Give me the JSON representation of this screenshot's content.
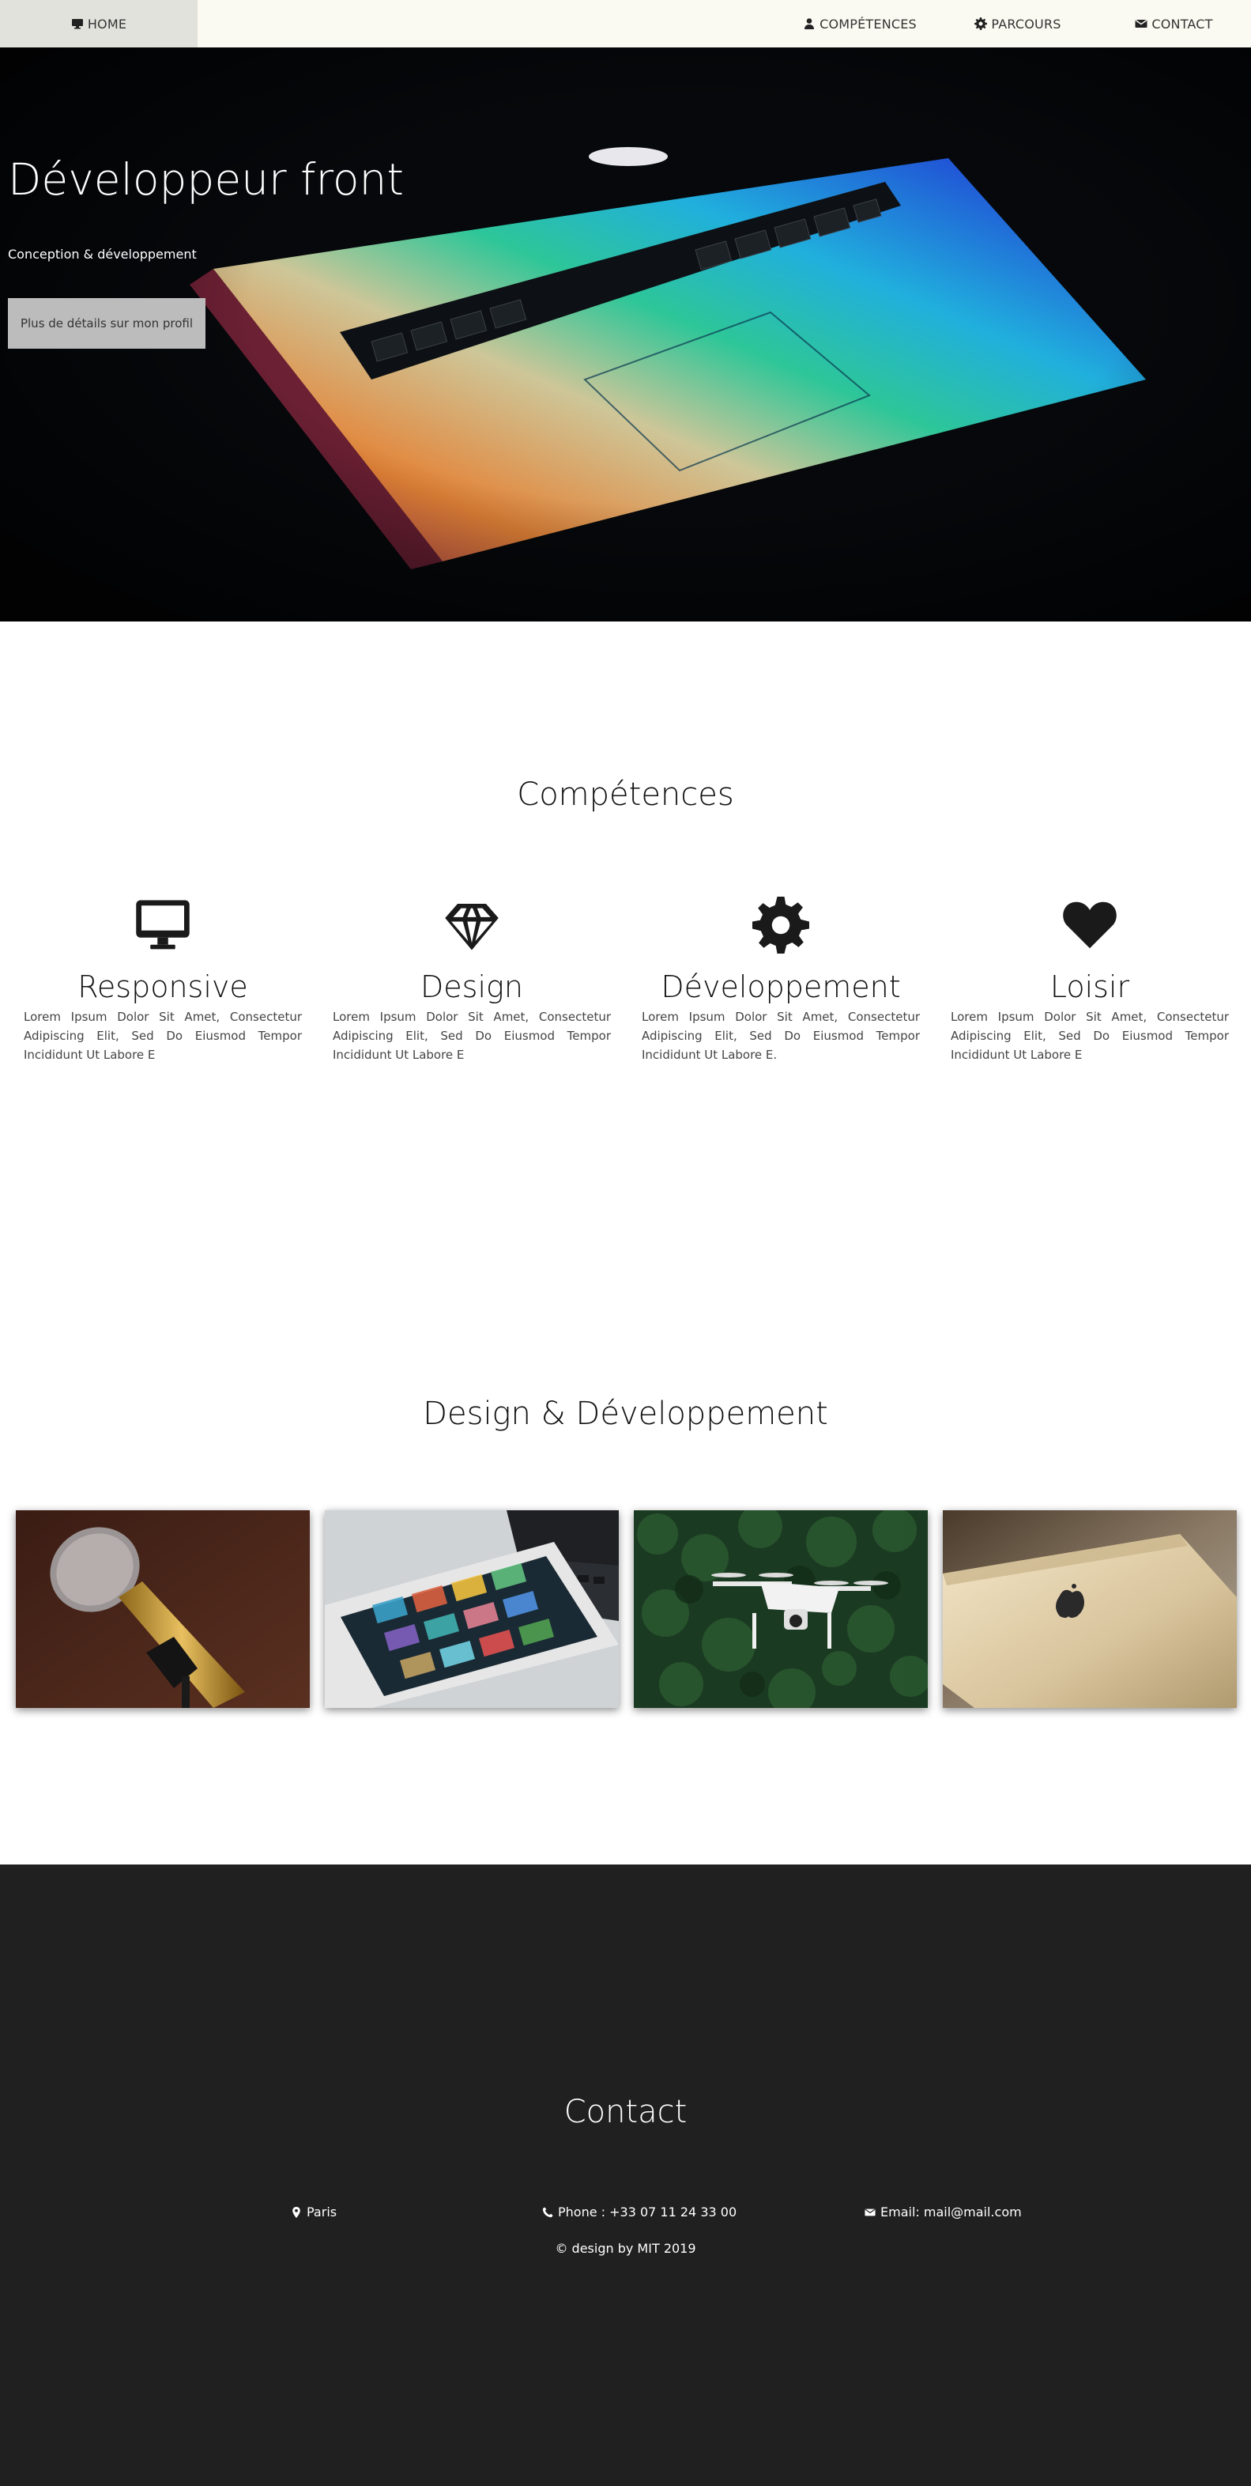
{
  "nav": {
    "home": "HOME",
    "competences": "COMPÉTENCES",
    "parcours": "PARCOURS",
    "contact": "CONTACT"
  },
  "hero": {
    "title": "Développeur front",
    "subtitle": "Conception & développement",
    "button": "Plus de détails sur mon profil"
  },
  "competences": {
    "title": "Compétences",
    "items": [
      {
        "icon": "desktop-icon",
        "name": "Responsive",
        "text": "Lorem Ipsum Dolor Sit Amet, Consectetur Adipiscing Elit, Sed Do Eiusmod Tempor Incididunt Ut Labore E"
      },
      {
        "icon": "diamond-icon",
        "name": "Design",
        "text": "Lorem Ipsum Dolor Sit Amet, Consectetur Adipiscing Elit, Sed Do Eiusmod Tempor Incididunt Ut Labore E"
      },
      {
        "icon": "gear-icon",
        "name": "Développement",
        "text": "Lorem Ipsum Dolor Sit Amet, Consectetur Adipiscing Elit, Sed Do Eiusmod Tempor Incididunt Ut Labore E."
      },
      {
        "icon": "heart-icon",
        "name": "Loisir",
        "text": "Lorem Ipsum Dolor Sit Amet, Consectetur Adipiscing Elit, Sed Do Eiusmod Tempor Incididunt Ut Labore E"
      }
    ]
  },
  "portfolio": {
    "title": "Design & Développement",
    "images": [
      "microphone-photo",
      "tablet-laptop-photo",
      "drone-photo",
      "iphone-photo"
    ]
  },
  "contact": {
    "title": "Contact",
    "location": "Paris",
    "phone": "Phone : +33 07 11 24 33 00",
    "email": "Email: mail@mail.com",
    "copyright": "© design by MIT 2019"
  },
  "colors": {
    "nav_bg": "#fafaf2",
    "nav_active_bg": "#e2e2dc",
    "hero_bg": "#06080b",
    "button_bg": "#bcbcbc",
    "footer_bg": "#202020"
  }
}
